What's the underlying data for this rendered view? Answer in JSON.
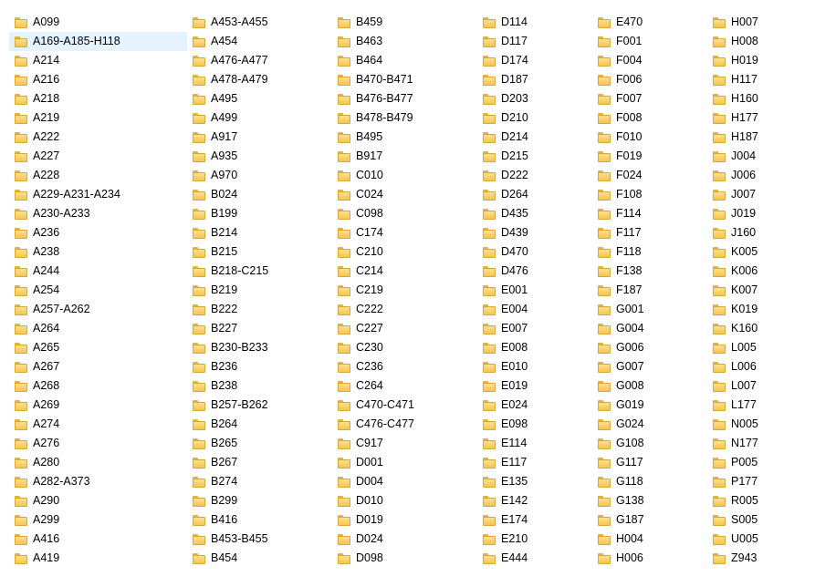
{
  "selected": "A169-A185-H118",
  "columns": [
    [
      "A099",
      "A169-A185-H118",
      "A214",
      "A216",
      "A218",
      "A219",
      "A222",
      "A227",
      "A228",
      "A229-A231-A234",
      "A230-A233",
      "A236",
      "A238",
      "A244",
      "A254",
      "A257-A262",
      "A264",
      "A265",
      "A267",
      "A268",
      "A269",
      "A274",
      "A276",
      "A280",
      "A282-A373",
      "A290",
      "A299",
      "A416",
      "A419"
    ],
    [
      "A453-A455",
      "A454",
      "A476-A477",
      "A478-A479",
      "A495",
      "A499",
      "A917",
      "A935",
      "A970",
      "B024",
      "B199",
      "B214",
      "B215",
      "B218-C215",
      "B219",
      "B222",
      "B227",
      "B230-B233",
      "B236",
      "B238",
      "B257-B262",
      "B264",
      "B265",
      "B267",
      "B274",
      "B299",
      "B416",
      "B453-B455",
      "B454"
    ],
    [
      "B459",
      "B463",
      "B464",
      "B470-B471",
      "B476-B477",
      "B478-B479",
      "B495",
      "B917",
      "C010",
      "C024",
      "C098",
      "C174",
      "C210",
      "C214",
      "C219",
      "C222",
      "C227",
      "C230",
      "C236",
      "C264",
      "C470-C471",
      "C476-C477",
      "C917",
      "D001",
      "D004",
      "D010",
      "D019",
      "D024",
      "D098"
    ],
    [
      "D114",
      "D117",
      "D174",
      "D187",
      "D203",
      "D210",
      "D214",
      "D215",
      "D222",
      "D264",
      "D435",
      "D439",
      "D470",
      "D476",
      "E001",
      "E004",
      "E007",
      "E008",
      "E010",
      "E019",
      "E024",
      "E098",
      "E114",
      "E117",
      "E135",
      "E142",
      "E174",
      "E210",
      "E444"
    ],
    [
      "E470",
      "F001",
      "F004",
      "F006",
      "F007",
      "F008",
      "F010",
      "F019",
      "F024",
      "F108",
      "F114",
      "F117",
      "F118",
      "F138",
      "F187",
      "G001",
      "G004",
      "G006",
      "G007",
      "G008",
      "G019",
      "G024",
      "G108",
      "G117",
      "G118",
      "G138",
      "G187",
      "H004",
      "H006"
    ],
    [
      "H007",
      "H008",
      "H019",
      "H117",
      "H160",
      "H177",
      "H187",
      "J004",
      "J006",
      "J007",
      "J019",
      "J160",
      "K005",
      "K006",
      "K007",
      "K019",
      "K160",
      "L005",
      "L006",
      "L007",
      "L177",
      "N005",
      "N177",
      "P005",
      "P177",
      "R005",
      "S005",
      "U005",
      "Z943"
    ]
  ]
}
